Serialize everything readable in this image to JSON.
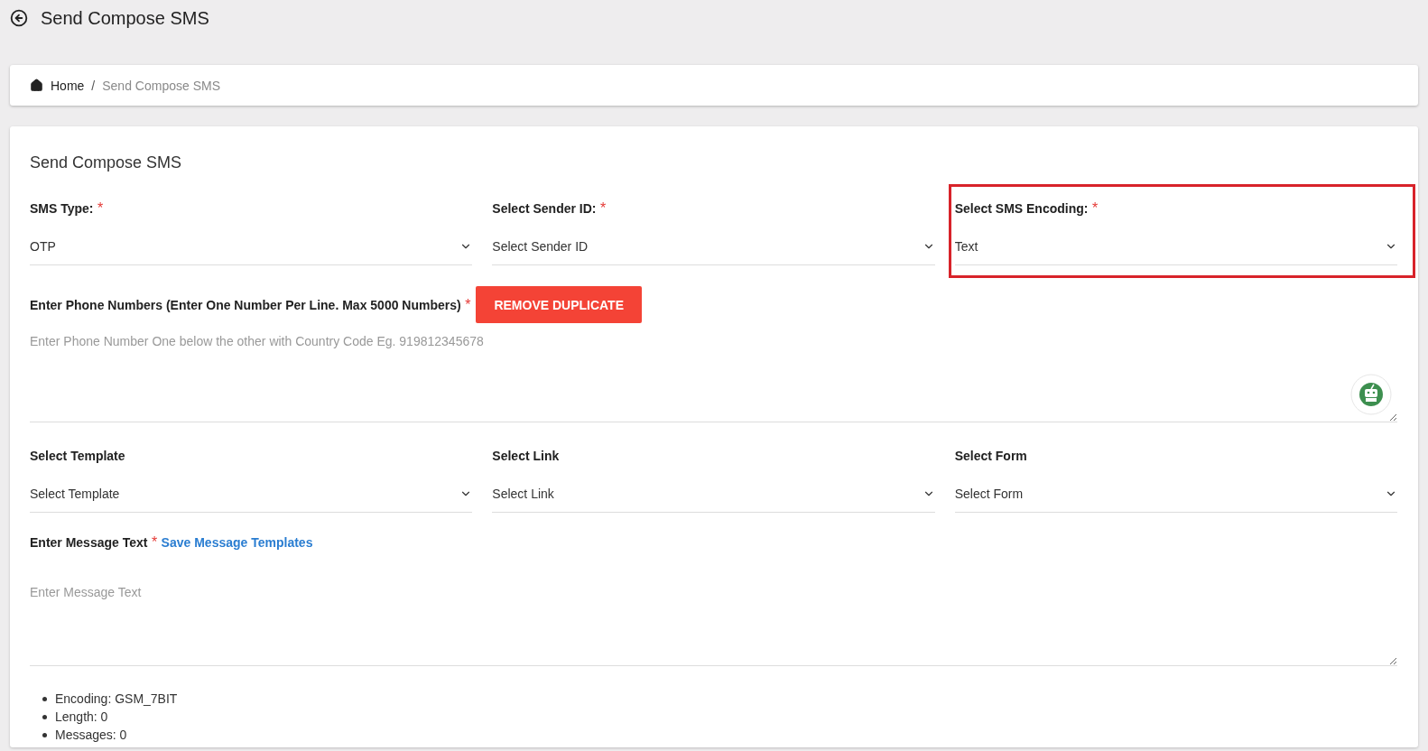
{
  "header": {
    "title": "Send Compose SMS"
  },
  "breadcrumb": [
    {
      "label": "Home",
      "kind": "link"
    },
    {
      "label": "Send Compose SMS",
      "kind": "current",
      "separator": "/"
    }
  ],
  "form": {
    "title": "Send Compose SMS",
    "row_1": [
      {
        "label": "SMS Type:",
        "required_mark": "*",
        "value": "OTP",
        "highlighted": false
      },
      {
        "label": "Select Sender ID:",
        "required_mark": "*",
        "value": "Select Sender ID",
        "highlighted": false
      },
      {
        "label": "Select SMS Encoding:",
        "required_mark": "*",
        "value": "Text",
        "highlighted": true
      }
    ],
    "phone": {
      "label": "Enter Phone Numbers (Enter One Number Per Line. Max 5000 Numbers)",
      "required_mark": "*",
      "button": "REMOVE DUPLICATE",
      "placeholder": "Enter Phone Number One below the other with Country Code Eg. 919812345678"
    },
    "row_2": [
      {
        "label": "Select Template",
        "value": "Select Template",
        "highlighted": false
      },
      {
        "label": "Select Link",
        "value": "Select Link",
        "highlighted": false
      },
      {
        "label": "Select Form",
        "value": "Select Form",
        "highlighted": false
      }
    ],
    "message": {
      "label": "Enter Message Text",
      "required_mark": "*",
      "link": "Save Message Templates",
      "placeholder": "Enter Message Text"
    },
    "stats": [
      "Encoding: GSM_7BIT",
      "Length: 0",
      "Messages: 0"
    ]
  }
}
